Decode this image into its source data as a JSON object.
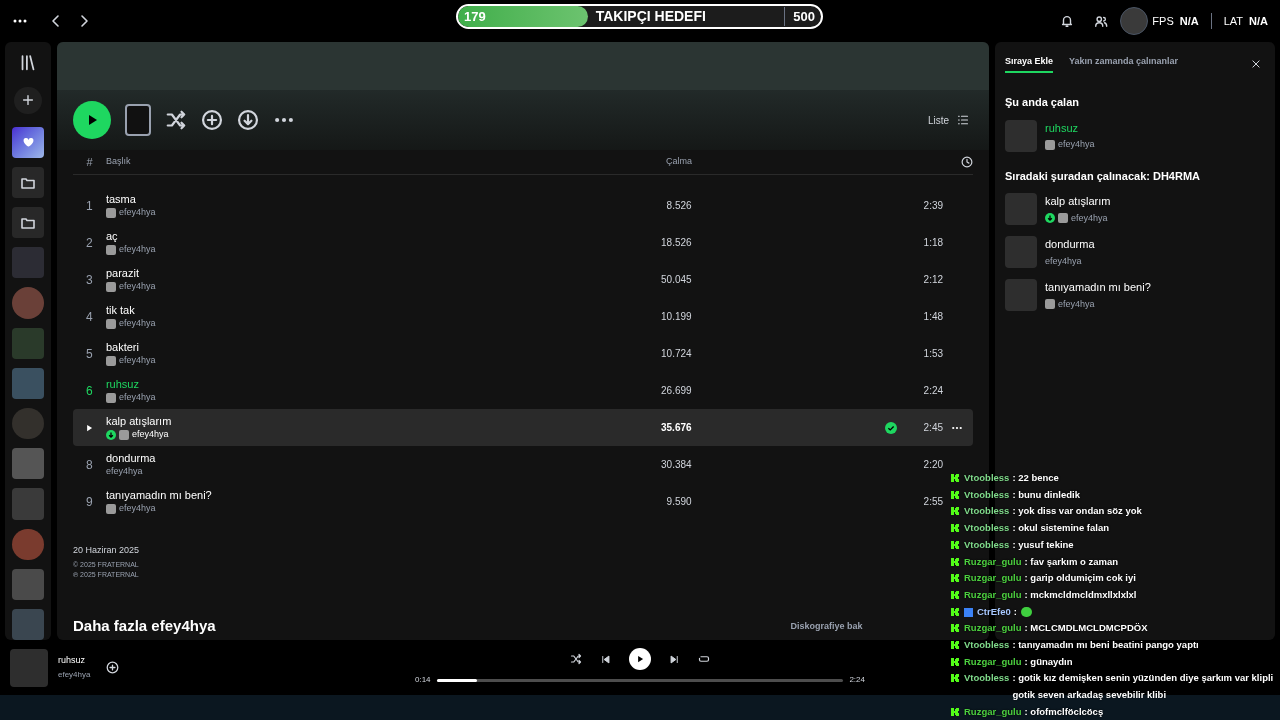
{
  "top_bar": {
    "goal": {
      "current": "179",
      "label": "TAKIPÇI HEDEFI",
      "target": "500",
      "level": 0.358
    },
    "stats": [
      {
        "label": "FPS",
        "value": "N/A"
      },
      {
        "label": "LAT",
        "value": "N/A"
      }
    ]
  },
  "sidebar": {
    "items": [
      {
        "kind": "liked"
      },
      {
        "kind": "folder"
      },
      {
        "kind": "folder"
      },
      {
        "kind": "cover"
      },
      {
        "kind": "cover"
      },
      {
        "kind": "cover"
      },
      {
        "kind": "cover"
      },
      {
        "kind": "cover"
      },
      {
        "kind": "cover"
      },
      {
        "kind": "cover"
      },
      {
        "kind": "cover"
      },
      {
        "kind": "cover"
      },
      {
        "kind": "cover"
      }
    ]
  },
  "toolbar": {
    "view_label": "Liste"
  },
  "table": {
    "columns": [
      "#",
      "Başlık",
      "Çalma"
    ],
    "rows": [
      {
        "number": "1",
        "title": "tasma",
        "artist": "efey4hya",
        "explicit": true,
        "downloaded": false,
        "playing": false,
        "selected": false,
        "saved": false,
        "plays": "8.526",
        "duration": "2:39"
      },
      {
        "number": "2",
        "title": "aç",
        "artist": "efey4hya",
        "explicit": true,
        "downloaded": false,
        "playing": false,
        "selected": false,
        "saved": false,
        "plays": "18.526",
        "duration": "1:18"
      },
      {
        "number": "3",
        "title": "parazit",
        "artist": "efey4hya",
        "explicit": true,
        "downloaded": false,
        "playing": false,
        "selected": false,
        "saved": false,
        "plays": "50.045",
        "duration": "2:12"
      },
      {
        "number": "4",
        "title": "tik tak",
        "artist": "efey4hya",
        "explicit": true,
        "downloaded": false,
        "playing": false,
        "selected": false,
        "saved": false,
        "plays": "10.199",
        "duration": "1:48"
      },
      {
        "number": "5",
        "title": "bakteri",
        "artist": "efey4hya",
        "explicit": true,
        "downloaded": false,
        "playing": false,
        "selected": false,
        "saved": false,
        "plays": "10.724",
        "duration": "1:53"
      },
      {
        "number": "6",
        "title": "ruhsuz",
        "artist": "efey4hya",
        "explicit": true,
        "downloaded": false,
        "playing": true,
        "selected": false,
        "saved": false,
        "plays": "26.699",
        "duration": "2:24"
      },
      {
        "title": "kalp atışlarım",
        "artist": "efey4hya",
        "explicit": true,
        "downloaded": true,
        "playing": false,
        "selected": true,
        "saved": true,
        "plays": "35.676",
        "duration": "2:45"
      },
      {
        "number": "8",
        "title": "dondurma",
        "artist": "efey4hya",
        "explicit": false,
        "downloaded": false,
        "playing": false,
        "selected": false,
        "saved": false,
        "plays": "30.384",
        "duration": "2:20"
      },
      {
        "number": "9",
        "title": "tanıyamadın mı beni?",
        "artist": "efey4hya",
        "explicit": true,
        "downloaded": false,
        "playing": false,
        "selected": false,
        "saved": false,
        "plays": "9.590",
        "duration": "2:55"
      }
    ]
  },
  "release": {
    "date": "20 Haziran 2025",
    "copyright": "© 2025 FRATERNAL",
    "phonogram": "℗ 2025 FRATERNAL"
  },
  "more_by": {
    "title": "Daha fazla efey4hya",
    "link": "Diskografiye bak"
  },
  "queue": {
    "tabs": [
      {
        "label": "Sıraya Ekle",
        "selected": true
      },
      {
        "label": "Yakın zamanda çalınanlar",
        "selected": false
      }
    ],
    "now_title": "Şu anda çalan",
    "now": {
      "title": "ruhsuz",
      "artist": "efey4hya",
      "explicit": true,
      "downloaded": false,
      "playing": true
    },
    "next_title": "Sıradaki şuradan çalınacak: DH4RMA",
    "next": [
      {
        "title": "kalp atışlarım",
        "artist": "efey4hya",
        "explicit": true,
        "downloaded": true,
        "playing": false
      },
      {
        "title": "dondurma",
        "artist": "efey4hya",
        "explicit": false,
        "downloaded": false,
        "playing": false
      },
      {
        "title": "tanıyamadın mı beni?",
        "artist": "efey4hya",
        "explicit": true,
        "downloaded": false,
        "playing": false
      }
    ]
  },
  "player": {
    "title": "ruhsuz",
    "artist": "efey4hya",
    "elapsed": "0:14",
    "total": "2:24",
    "level": 0.1
  },
  "chat": [
    {
      "kind": "text",
      "user": "Vtoobless",
      "color": "#7fd98a",
      "text": ": 22 bence"
    },
    {
      "kind": "text",
      "user": "Vtoobless",
      "color": "#7fd98a",
      "text": ": bunu dinledik"
    },
    {
      "kind": "text",
      "user": "Vtoobless",
      "color": "#7fd98a",
      "text": ": yok diss var ondan söz yok"
    },
    {
      "kind": "text",
      "user": "Vtoobless",
      "color": "#7fd98a",
      "text": ": okul sistemine falan"
    },
    {
      "kind": "text",
      "user": "Vtoobless",
      "color": "#7fd98a",
      "text": ": yusuf tekine"
    },
    {
      "kind": "text",
      "user": "Ruzgar_gulu",
      "color": "#4ccf3f",
      "text": ": fav şarkım o zaman"
    },
    {
      "kind": "text",
      "user": "Ruzgar_gulu",
      "color": "#4ccf3f",
      "text": ": garip oldumiçim cok iyi"
    },
    {
      "kind": "text",
      "user": "Ruzgar_gulu",
      "color": "#4ccf3f",
      "text": ": mckmcldmcldmxllxlxlxl"
    },
    {
      "kind": "emote",
      "user": "CtrEfe0",
      "color": "#a8c8ff",
      "text": ":"
    },
    {
      "kind": "text",
      "user": "Ruzgar_gulu",
      "color": "#4ccf3f",
      "text": ": MCLCMDLMCLDMCPDÖX"
    },
    {
      "kind": "text",
      "user": "Vtoobless",
      "color": "#7fd98a",
      "text": ": tanıyamadın mı beni beatini pango yaptı"
    },
    {
      "kind": "text",
      "user": "Ruzgar_gulu",
      "color": "#4ccf3f",
      "text": ": günaydın"
    },
    {
      "kind": "text",
      "user": "Vtoobless",
      "color": "#7fd98a",
      "text": ": gotik kız demişken senin yüzünden diye şarkım var klipli gotik seven arkadaş sevebilir klibi"
    },
    {
      "kind": "text",
      "user": "Ruzgar_gulu",
      "color": "#4ccf3f",
      "text": ": ofofmclföclcöcş"
    }
  ]
}
